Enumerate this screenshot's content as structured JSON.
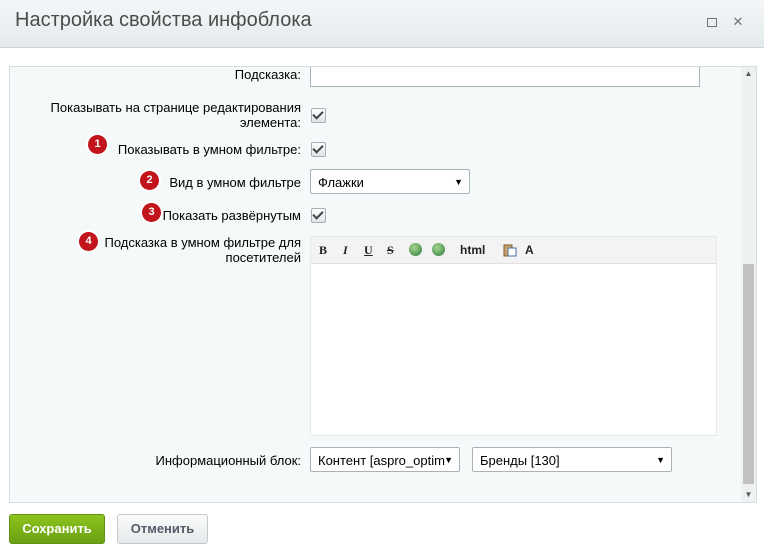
{
  "dialog": {
    "title": "Настройка свойства инфоблока",
    "controls": {
      "maximize_icon": "maximize-icon",
      "close_icon": "close-icon",
      "close_glyph": "✕"
    }
  },
  "form": {
    "hint": {
      "label": "Подсказка:",
      "value": ""
    },
    "show_on_edit": {
      "label_line1": "Показывать на странице редактирования",
      "label_line2": "элемента:",
      "checked": true
    },
    "smart_filter": {
      "badge": "1",
      "label": "Показывать в умном фильтре:",
      "checked": true
    },
    "smart_filter_view": {
      "badge": "2",
      "label": "Вид в умном фильтре",
      "value": "Флажки"
    },
    "expanded": {
      "badge": "3",
      "label": "Показать развёрнутым",
      "checked": true
    },
    "smart_filter_hint": {
      "badge": "4",
      "label_line1": "Подсказка в умном фильтре для",
      "label_line2": "посетителей",
      "toolbar": {
        "bold": "B",
        "italic": "I",
        "underline": "U",
        "strike": "S",
        "link_icon": "insert-link-icon",
        "unlink_icon": "remove-link-icon",
        "html": "html",
        "paste_icon": "paste-icon",
        "format_icon": "font-format-icon",
        "format_glyph": "A"
      }
    },
    "iblock": {
      "label": "Информационный блок:",
      "type_value": "Контент [aspro_optim",
      "block_value": "Бренды [130]"
    }
  },
  "buttons": {
    "save": "Сохранить",
    "cancel": "Отменить"
  },
  "colors": {
    "save_button": "#7cb518",
    "badge": "#c1141b",
    "panel": "#f5f9f9"
  }
}
